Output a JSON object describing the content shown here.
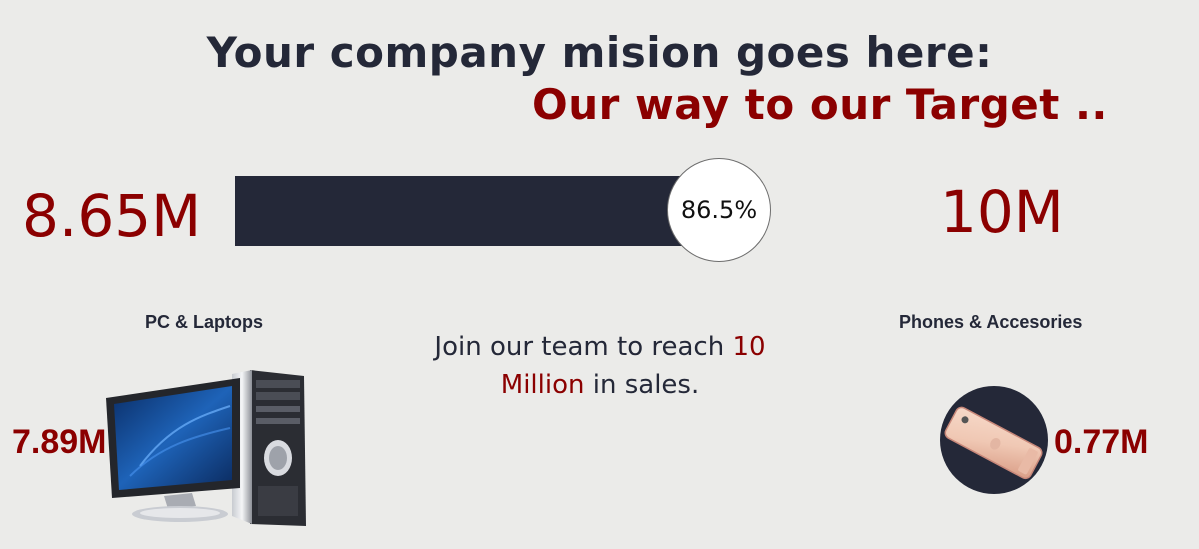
{
  "header": {
    "title": "Your company mision goes here:",
    "subtitle": "Our way to our Target .."
  },
  "progress": {
    "current": "8.65M",
    "target": "10M",
    "percent_label": "86.5%",
    "fraction": 0.865
  },
  "categories": [
    {
      "label": "PC & Laptops",
      "value": "7.89M",
      "icon": "desktop-computer-icon"
    },
    {
      "label": "Phones & Accesories",
      "value": "0.77M",
      "icon": "smartphone-icon"
    }
  ],
  "message": {
    "part1": "Join our team to reach ",
    "highlight": "10 Million",
    "part2": " in sales."
  },
  "colors": {
    "accent": "#8b0000",
    "dark": "#242838",
    "background": "#ebebe9"
  }
}
